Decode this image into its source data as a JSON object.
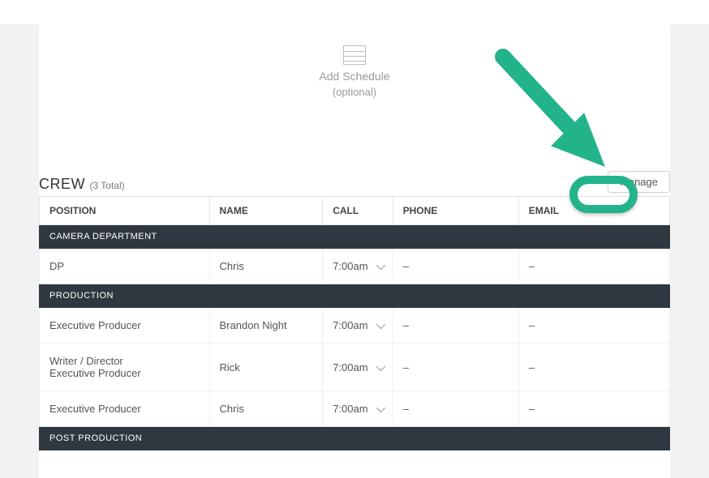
{
  "addSchedule": {
    "line1": "Add Schedule",
    "line2": "(optional)"
  },
  "crew": {
    "title": "CREW",
    "countLabel": "(3 Total)",
    "manageLabel": "Manage",
    "columns": {
      "position": "POSITION",
      "name": "NAME",
      "call": "CALL",
      "phone": "PHONE",
      "email": "EMAIL"
    },
    "departments": [
      {
        "name": "CAMERA DEPARTMENT",
        "rows": [
          {
            "position": "DP",
            "name": "Chris",
            "call": "7:00am",
            "phone": "–",
            "email": "–"
          }
        ]
      },
      {
        "name": "PRODUCTION",
        "rows": [
          {
            "position": "Executive Producer",
            "name": "Brandon Night",
            "call": "7:00am",
            "phone": "–",
            "email": "–"
          },
          {
            "position": "Writer / Director\nExecutive Producer",
            "name": "Rick",
            "call": "7:00am",
            "phone": "–",
            "email": "–"
          },
          {
            "position": "Executive Producer",
            "name": "Chris",
            "call": "7:00am",
            "phone": "–",
            "email": "–"
          }
        ]
      },
      {
        "name": "POST PRODUCTION",
        "rows": []
      }
    ]
  }
}
